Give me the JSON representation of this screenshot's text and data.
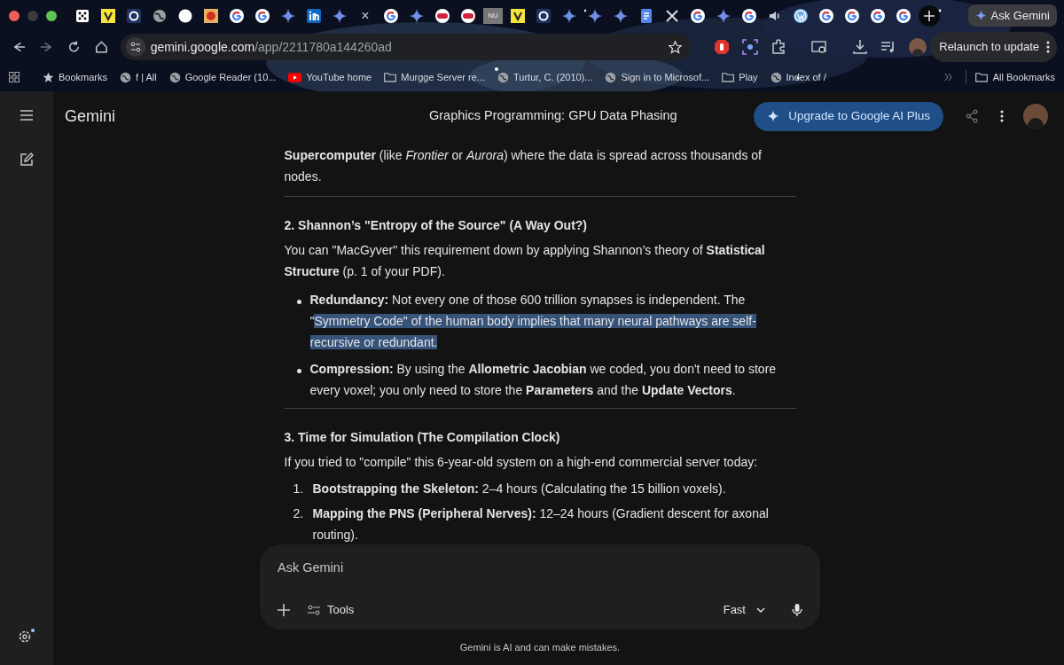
{
  "tabs": [
    {
      "kind": "dice"
    },
    {
      "kind": "yellow"
    },
    {
      "kind": "ring"
    },
    {
      "kind": "globe"
    },
    {
      "kind": "circle"
    },
    {
      "kind": "red"
    },
    {
      "kind": "google"
    },
    {
      "kind": "google"
    },
    {
      "kind": "spark"
    },
    {
      "kind": "linkedin"
    },
    {
      "kind": "spark"
    },
    {
      "kind": "close",
      "label": "×"
    },
    {
      "kind": "google"
    },
    {
      "kind": "spark"
    },
    {
      "kind": "pill"
    },
    {
      "kind": "pill"
    },
    {
      "kind": "text",
      "label": "NU"
    },
    {
      "kind": "yellow"
    },
    {
      "kind": "ring"
    },
    {
      "kind": "spark"
    },
    {
      "kind": "spark"
    },
    {
      "kind": "spark"
    },
    {
      "kind": "docs"
    },
    {
      "kind": "x"
    },
    {
      "kind": "google"
    },
    {
      "kind": "spark"
    },
    {
      "kind": "google"
    },
    {
      "kind": "speaker"
    },
    {
      "kind": "wordpress"
    },
    {
      "kind": "google"
    },
    {
      "kind": "google"
    },
    {
      "kind": "google"
    },
    {
      "kind": "google"
    }
  ],
  "ask_gemini_button": "Ask Gemini",
  "address": {
    "domain": "gemini.google.com",
    "path": "/app/2211780a144260ad"
  },
  "relaunch_button": "Relaunch to update",
  "bookmarks": [
    {
      "label": "Bookmarks",
      "kind": "star"
    },
    {
      "label": "f | All",
      "kind": "globe"
    },
    {
      "label": "Google Reader (10...",
      "kind": "globe"
    },
    {
      "label": "YouTube home",
      "kind": "youtube"
    },
    {
      "label": "Murgge Server re...",
      "kind": "folder"
    },
    {
      "label": "Turtur, C. (2010)...",
      "kind": "globe"
    },
    {
      "label": "Sign in to Microsof...",
      "kind": "globe"
    },
    {
      "label": "Play",
      "kind": "folder"
    },
    {
      "label": "Index of /",
      "kind": "globe"
    }
  ],
  "all_bookmarks": "All Bookmarks",
  "app": {
    "name": "Gemini",
    "chat_title": "Graphics Programming: GPU Data Phasing",
    "upgrade_button": "Upgrade to Google AI Plus"
  },
  "content": [
    {
      "kind": "paragraph",
      "text": "**Supercomputer** (like *Frontier* or *Aurora*) where the data is spread across thousands of nodes."
    },
    {
      "kind": "rule"
    },
    {
      "kind": "heading",
      "text": "2. Shannon’s \"Entropy of the Source\" (A Way Out?)"
    },
    {
      "kind": "paragraph",
      "text": "You can \"MacGyver\" this requirement down by applying Shannon’s theory of **Statistical Structure** (p. 1 of your PDF)."
    },
    {
      "kind": "bullets",
      "items": [
        {
          "segments": [
            {
              "text": "**Redundancy:** Not every one of those 600 trillion synapses is independent. The \"",
              "highlighted": false
            },
            {
              "text": "Symmetry Code\" of the human body implies that many neural pathways are self-recursive or redundant.",
              "highlighted": true
            }
          ]
        },
        {
          "segments": [
            {
              "text": "**Compression:** By using the **Allometric Jacobian** we coded, you don't need to store every voxel; you only need to store the **Parameters** and the **Update Vectors**.",
              "highlighted": false
            }
          ]
        }
      ]
    },
    {
      "kind": "rule"
    },
    {
      "kind": "heading",
      "text": "3. Time for Simulation (The Compilation Clock)"
    },
    {
      "kind": "paragraph",
      "text": "If you tried to \"compile\" this 6-year-old system on a high-end commercial server today:"
    },
    {
      "kind": "numbered",
      "items": [
        {
          "number": "1.",
          "text": "**Bootstrapping the Skeleton:** 2–4 hours (Calculating the 15 billion voxels)."
        },
        {
          "number": "2.",
          "text": "**Mapping the PNS (Peripheral Nerves):** 12–24 hours (Gradient descent for axonal routing)."
        }
      ]
    }
  ],
  "composer": {
    "placeholder": "Ask Gemini",
    "tools_button": "Tools",
    "mode_button": "Fast"
  },
  "disclaimer": "Gemini is AI and can make mistakes."
}
